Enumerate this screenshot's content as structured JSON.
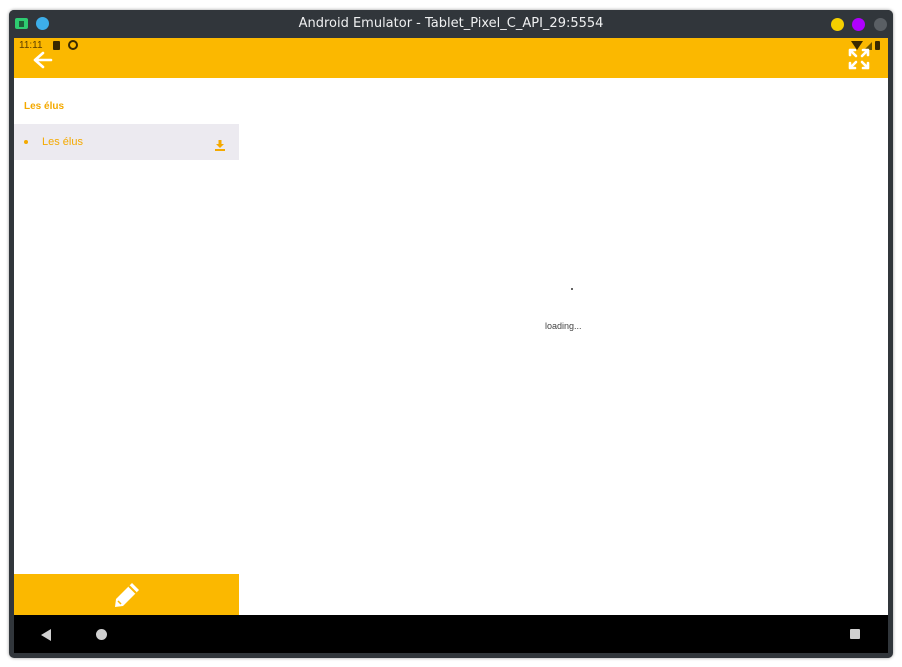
{
  "window": {
    "title": "Android Emulator - Tablet_Pixel_C_API_29:5554"
  },
  "status_bar": {
    "time": "11:11"
  },
  "sidebar": {
    "section_title": "Les élus",
    "documents": [
      {
        "label": "Les élus"
      }
    ]
  },
  "content": {
    "loading_text": "loading..."
  },
  "colors": {
    "accent": "#fbb800",
    "accent_text": "#f4a900",
    "selected_item_bg": "#eceaf0",
    "nav_bar": "#000000",
    "window_chrome": "#31363b"
  },
  "icons": {
    "back": "arrow-left-icon",
    "fullscreen": "fullscreen-expand-icon",
    "download": "download-icon",
    "edit": "pencil-icon"
  }
}
